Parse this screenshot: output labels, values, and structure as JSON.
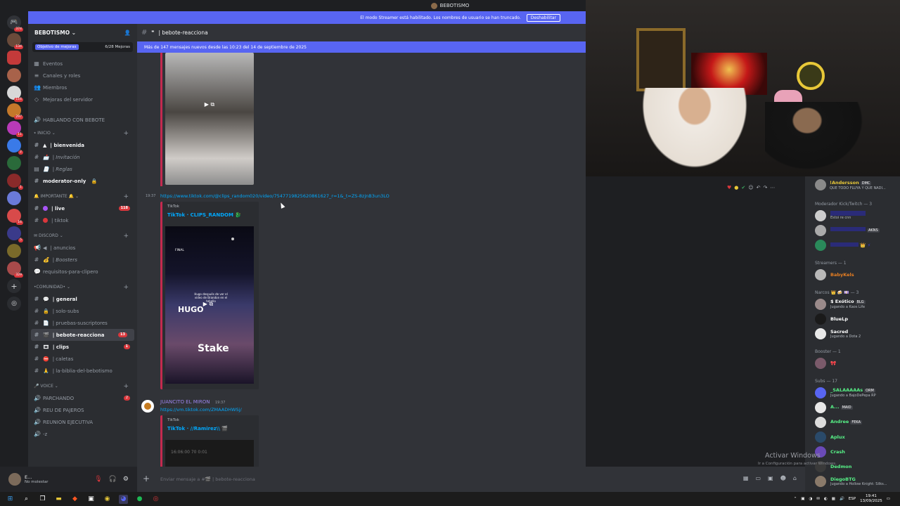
{
  "window": {
    "title": "BEBOTISMO"
  },
  "banner": {
    "text": "El modo Streamer está habilitado. Los nombres de usuario se han truncado.",
    "button": "Deshabilitar"
  },
  "rail": {
    "badges": [
      "374",
      "134",
      "",
      "116",
      "297",
      "11",
      "2",
      "",
      "1",
      "",
      "16",
      "5",
      "",
      "329"
    ]
  },
  "guild": {
    "name": "BEBOTISMO",
    "goal_label": "Objetivo de mejoras",
    "goal_value": "6/28 Mejoras",
    "menu": [
      "Eventos",
      "Canales y roles",
      "Miembros",
      "Mejoras del servidor"
    ],
    "hablando": "HABLANDO CON BEBOTE",
    "categories": {
      "inicio": "INICIO",
      "importante": "IMPORTANTE",
      "discord": "DISCORD",
      "comunidad": "•COMUNIDAD•",
      "voice": "VOICE"
    },
    "channels": {
      "bienvenida": "| bienvenida",
      "invitacion": "| Invitación",
      "reglas": "| Reglas",
      "moderator": "moderator-only",
      "live": "| live",
      "live_badge": "118",
      "tiktok": "| tiktok",
      "anuncios": "| anuncios",
      "boosters": "| Boosters",
      "requisitos": "requisitos-para-clipero",
      "general": "| general",
      "solosubs": "| solo-subs",
      "pruebas": "| pruebas-suscriptores",
      "bebote": "| bebote-reacciona",
      "bebote_badge": "13",
      "clips": "| clips",
      "clips_badge": "1",
      "caletas": "| caletas",
      "biblia": "| la-biblia-del-bebotismo",
      "parchando": "PARCHANDO",
      "parchando_badge": "2",
      "reu": "REU DE PAJEROS",
      "reunion": "REUNION EJECUTIVA",
      "zz": "-z"
    }
  },
  "user": {
    "name": "E...",
    "status": "No molestar"
  },
  "chat": {
    "channel": "| bebote-reacciona",
    "newbar": "Más de 147 mensajes nuevos desde las 10:23 del 14 de septiembre de 2025",
    "msg1_time": "19:37",
    "msg1_link": "https://www.tiktok.com/@clips_random020/video/7547719825620861627_r=1&_t=ZS-8zjnB3un3LO",
    "embed1_provider": "TikTok",
    "embed1_title": "TikTok · CLIPS_RANDOM 🐉",
    "video_text_top": "FINAL",
    "video_caption": "Hugo después de ver el video de Brandon en el tebello",
    "video_hugo": "HUGO",
    "video_brand": "Stake",
    "msg2_author": "JUANCITO EL MIRON",
    "msg2_time": "19:37",
    "msg2_link": "https://vm.tiktok.com/ZMAADHWSj/",
    "embed2_provider": "TikTok",
    "embed2_title": "TikTok · //Ramirez\\\\ 🎬",
    "video2_text": "16:06:00 70 0:01",
    "composer_placeholder": "Enviar mensaje a #🎬 | bebote-reacciona"
  },
  "members": {
    "top_name": "!Andersson",
    "top_tag": "DMC",
    "top_status": "QUE TODO FLUYA Y QUE NADI...",
    "groups": [
      {
        "title": "Moderador Kick/Twitch — 3"
      },
      {
        "title": "Streamers — 1"
      },
      {
        "title": "Narcos 👑 🍻 💷 — 3"
      },
      {
        "title": "Booster — 1"
      },
      {
        "title": "Subs — 17"
      }
    ],
    "mods": [
      {
        "name": "",
        "sub": "Estoi re cnn"
      },
      {
        "name": "",
        "tag": "AKNS"
      },
      {
        "name": ""
      }
    ],
    "streamer": "BabyKels",
    "narcos": [
      {
        "name": "$ Exótico",
        "tag": "BLG",
        "sub": "Jugando a Kaos Life"
      },
      {
        "name": "BlueLp"
      },
      {
        "name": "Sacred",
        "sub": "Jugando a Dota 2"
      }
    ],
    "subs": [
      {
        "name": "_SALAAAAAs",
        "tag": "ORM",
        "sub": "Jugando a BajoDePepa RP"
      },
      {
        "name": "A...",
        "tag": "MAID"
      },
      {
        "name": "Andree",
        "tag": "FEKA"
      },
      {
        "name": "Aplux"
      },
      {
        "name": "Crash"
      },
      {
        "name": "Dedmon"
      },
      {
        "name": "DiegoBTG",
        "sub": "Jugando a Hollow Knight: Silks..."
      }
    ]
  },
  "windows": {
    "activate": "Activar Windows",
    "activate_sub": "Ir a Configuración para activar Windows."
  },
  "tray": {
    "lang": "ESP",
    "time": "19:41",
    "date": "13/09/2025"
  }
}
